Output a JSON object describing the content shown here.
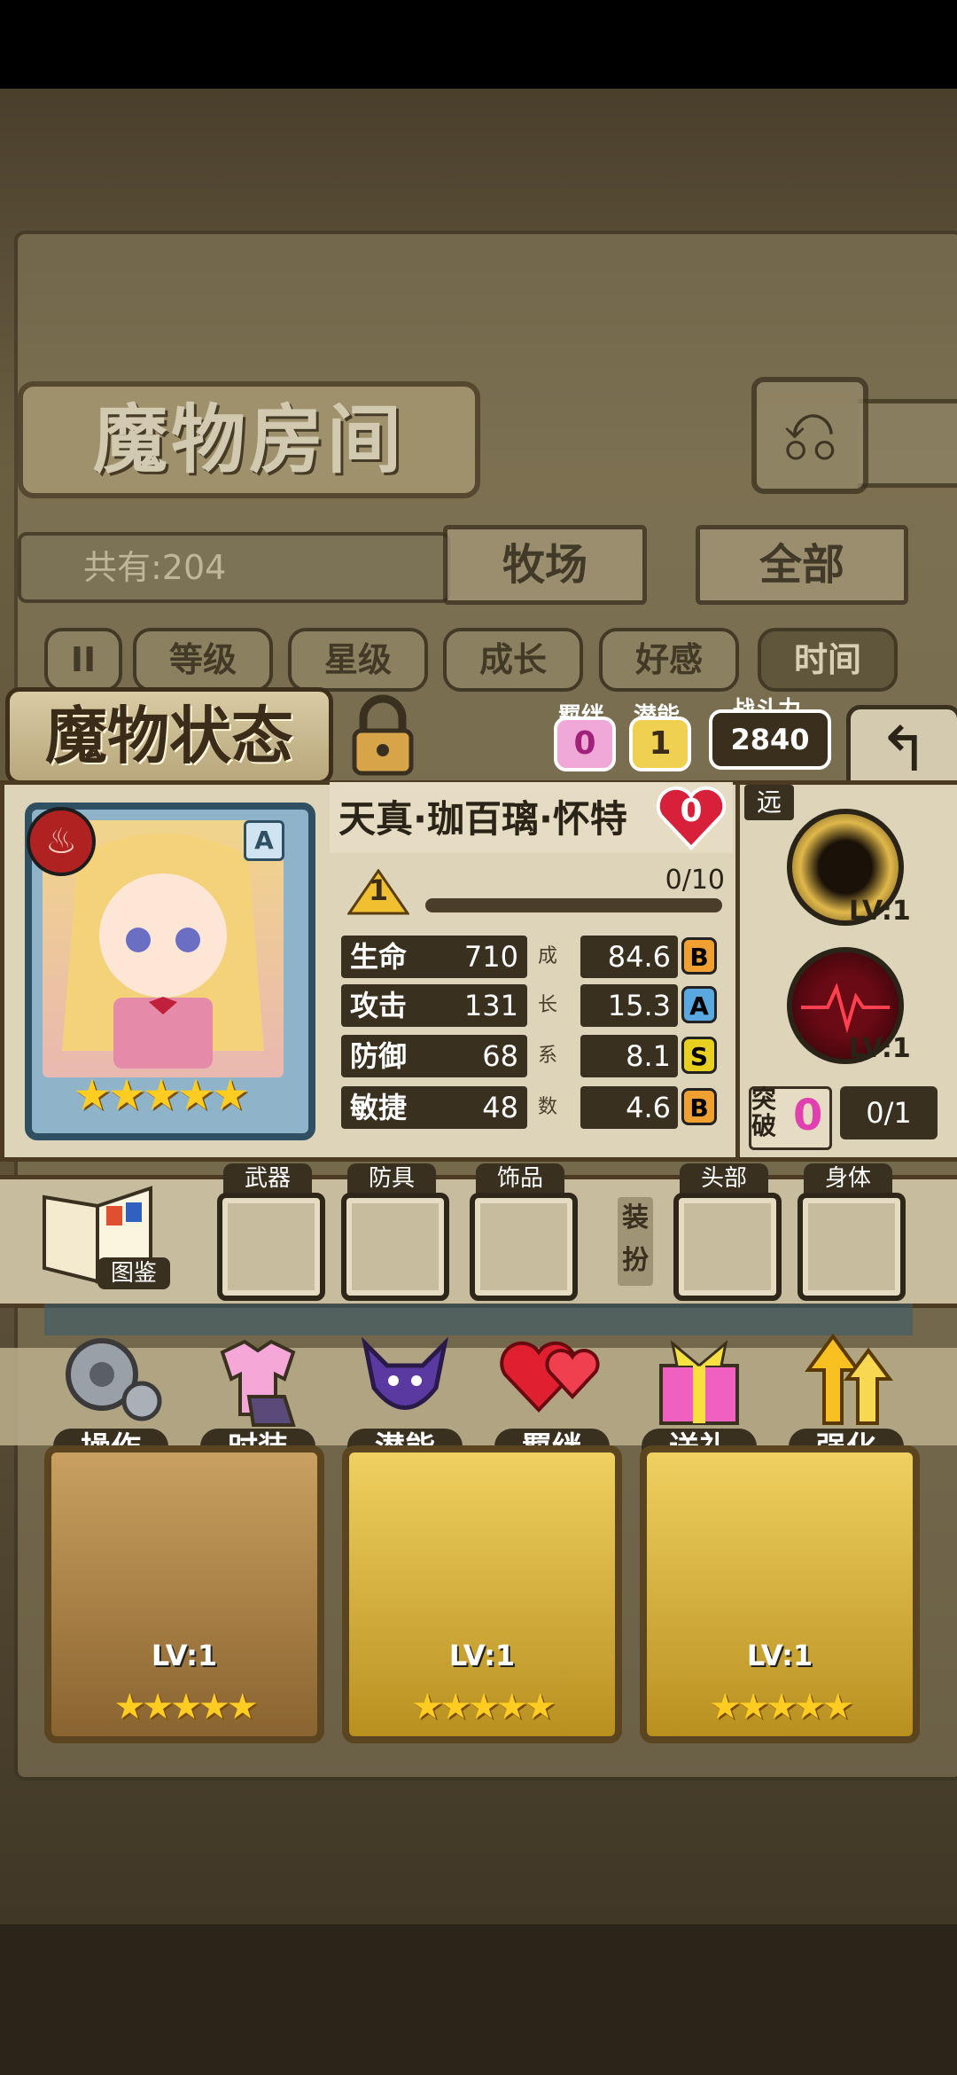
{
  "header": {
    "room_title": "魔物房间",
    "back_icon": "return-icon"
  },
  "collection": {
    "count_label": "共有:204"
  },
  "filter_tabs": [
    {
      "label": "牧场"
    },
    {
      "label": "全部"
    }
  ],
  "sort_buttons": [
    {
      "label": "II",
      "icon": "sort-toggle-icon"
    },
    {
      "label": "等级"
    },
    {
      "label": "星级"
    },
    {
      "label": "成长"
    },
    {
      "label": "好感"
    },
    {
      "label": "时间"
    }
  ],
  "status": {
    "title": "魔物状态",
    "bond_label": "羁绊",
    "bond_value": "0",
    "potential_label": "潜能",
    "potential_value": "1",
    "power_label": "战斗力",
    "power_value": "2840",
    "back_icon": "return-icon"
  },
  "monster": {
    "name": "天真·珈百璃·怀特",
    "heart_value": "0",
    "element_icon": "fire-icon",
    "rank": "A",
    "stars": "★★★★★",
    "level_badge": "1",
    "exp_text": "0/10",
    "exp_fraction": 0,
    "stats": [
      {
        "name": "生命",
        "value": "710",
        "mid": "成",
        "growth": "84.6",
        "grade": "B",
        "grade_color": "#f0a030"
      },
      {
        "name": "攻击",
        "value": "131",
        "mid": "长",
        "growth": "15.3",
        "grade": "A",
        "grade_color": "#5aa8e0"
      },
      {
        "name": "防御",
        "value": "68",
        "mid": "系",
        "growth": "8.1",
        "grade": "S",
        "grade_color": "#e8d020"
      },
      {
        "name": "敏捷",
        "value": "48",
        "mid": "数",
        "growth": "4.6",
        "grade": "B",
        "grade_color": "#f0a030"
      }
    ],
    "range": "远",
    "skills": [
      {
        "icon": "dark-vortex-icon",
        "lv": "LV:1"
      },
      {
        "icon": "heartbeat-icon",
        "lv": "LV:1"
      }
    ],
    "break_label": "突破",
    "break_value": "0",
    "break_progress": "0/1"
  },
  "equipment": {
    "book_label": "图鉴",
    "slots": [
      {
        "label": "武器"
      },
      {
        "label": "防具"
      },
      {
        "label": "饰品"
      },
      {
        "label": "头部"
      },
      {
        "label": "身体"
      }
    ],
    "dress_label": "装扮"
  },
  "actions": [
    {
      "label": "操作",
      "icon": "gear-icon"
    },
    {
      "label": "时装",
      "icon": "outfit-icon"
    },
    {
      "label": "潜能",
      "icon": "demon-icon"
    },
    {
      "label": "羁绊",
      "icon": "hearts-icon"
    },
    {
      "label": "送礼",
      "icon": "gift-icon"
    },
    {
      "label": "强化",
      "icon": "upgrade-arrows-icon"
    }
  ],
  "cards": [
    {
      "lv": "LV:1",
      "stars": "★★★★★"
    },
    {
      "lv": "LV:1",
      "stars": "★★★★★"
    },
    {
      "lv": "LV:1",
      "stars": "★★★★★"
    }
  ],
  "colors": {
    "accent_pink": "#e040b0",
    "heart_red": "#d8203a",
    "gold": "#ffcc22"
  }
}
